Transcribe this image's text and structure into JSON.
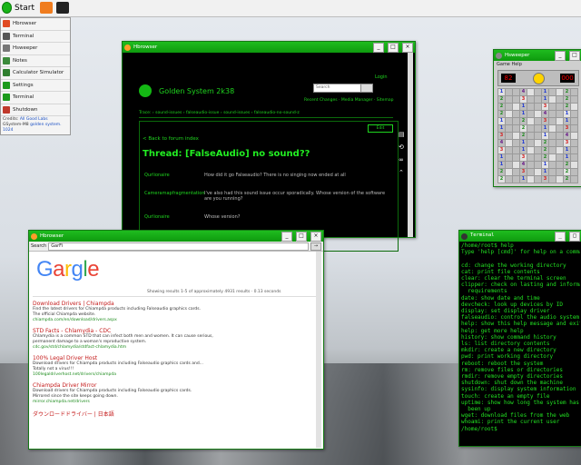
{
  "taskbar": {
    "start_label": "Start"
  },
  "start_menu": {
    "items": [
      {
        "label": "Hbrowser",
        "color": "#e04a22"
      },
      {
        "label": "Terminal",
        "color": "#555555"
      },
      {
        "label": "Hsweeper",
        "color": "#777777"
      },
      {
        "label": "Notes",
        "color": "#3b8a3b"
      },
      {
        "label": "Calculator Simulator",
        "color": "#2f7f2f"
      },
      {
        "label": "Settings",
        "color": "#1c9a1c"
      },
      {
        "label": "Terminal",
        "color": "#1c9a1c"
      },
      {
        "label": "Shutdown",
        "color": "#c0392b"
      }
    ],
    "footer": [
      "Credits:",
      "GSystem-M8"
    ],
    "footer_link": "All Good Labs",
    "footer_link2": "golden system. 1024"
  },
  "forum_window": {
    "title": "Hbrowser",
    "site_name": "Golden System 2k38",
    "login_link": "Login",
    "search_placeholder": "Search",
    "nav_links": "Recent Changes · Media Manager · Sitemap",
    "breadcrumb": "Trace: › sound-issues › falseaudio-issue › sound-issues › falseaudio-no-sound-z",
    "back_link": "< Back to forum index",
    "thread_title": "Thread: [FalseAudio] no sound??",
    "edit_label": "Edit",
    "posts": [
      {
        "user": "Qurlionaire",
        "text": "How did it go Falseaudio? There is no singing now ended at all"
      },
      {
        "user": "Cameramapfragmentation",
        "text": "I've also had this sound issue occur sporadically. Whose version of the software are you running?"
      },
      {
        "user": "Qurlionaire",
        "text": "Whose version?"
      }
    ]
  },
  "browser_window": {
    "title": "Hbrowser",
    "address_label": "Search",
    "address_value": "GarFi",
    "logo_letters": [
      {
        "ch": "G",
        "color": "#4285f4"
      },
      {
        "ch": "a",
        "color": "#ea4335"
      },
      {
        "ch": "r",
        "color": "#fbbc05"
      },
      {
        "ch": "g",
        "color": "#4285f4"
      },
      {
        "ch": "l",
        "color": "#34a853"
      },
      {
        "ch": "e",
        "color": "#ea4335"
      }
    ],
    "results_meta": "Showing results 1-5 of approximately 4931 results · 0.13 seconds",
    "results": [
      {
        "title": "Download Drivers | Chiampda",
        "desc": "Find the latest drivers for Chiampda products including Falseaudio graphics cards.",
        "desc2": "The official Chiampda website.",
        "url": "chiampda.com/en/download/drivers.aspx"
      },
      {
        "title": "STD Facts - Chlamydia - CDC",
        "desc": "Chlamydia is a common STD that can infect both men and women. It can cause serious,",
        "desc2": "permanent damage to a woman's reproductive system.",
        "url": "cdc.gov/std/chlamydia/stdfact-chlamydia.htm"
      },
      {
        "title": "100% Legal Driver Host",
        "desc": "Download drivers for Chiampda products including Falseaudio graphics cards and...",
        "desc2": "Totally not a virus!!!",
        "url": "100legaldriverhost.net/drivers/chiampda"
      },
      {
        "title": "Chiampda Driver Mirror",
        "desc": "Download drivers for Chiampda products including Falseaudio graphics cards.",
        "desc2": "Mirrored since the site keeps going down.",
        "url": "mirror.chiampda.net/drivers"
      },
      {
        "title": "ダウンロードドライバー | 日本語",
        "desc": "",
        "desc2": "",
        "url": ""
      }
    ]
  },
  "terminal_window": {
    "title": "Terminal",
    "lines": [
      "/home/root$ help",
      "Type 'help [cmd]' for help on a command in particular",
      "",
      "cd: change the working directory",
      "cat: print file contents",
      "clear: clear the terminal screen",
      "clipper: check on lasting and information",
      "  requirements",
      "date: show date and time",
      "devcheck: look up devices by ID",
      "display: set display driver",
      "falseaudio: control the audio system",
      "help: show this help message and exit",
      "help: get more help",
      "history: show command history",
      "ls: list directory contents",
      "mkdir: create a new directory",
      "pwd: print working directory",
      "reboot: reboot the system",
      "rm: remove files or directories",
      "rmdir: remove empty directories",
      "shutdown: shut down the machine",
      "sysinfo: display system information",
      "touch: create an empty file",
      "uptime: show how long the system has",
      "  been up",
      "wget: download files from the web",
      "whoami: print the current user",
      "/home/root$"
    ]
  },
  "mine_window": {
    "title": "Hsweeper",
    "menu": "Game   Help",
    "counter_left": "82",
    "counter_right": "000"
  }
}
